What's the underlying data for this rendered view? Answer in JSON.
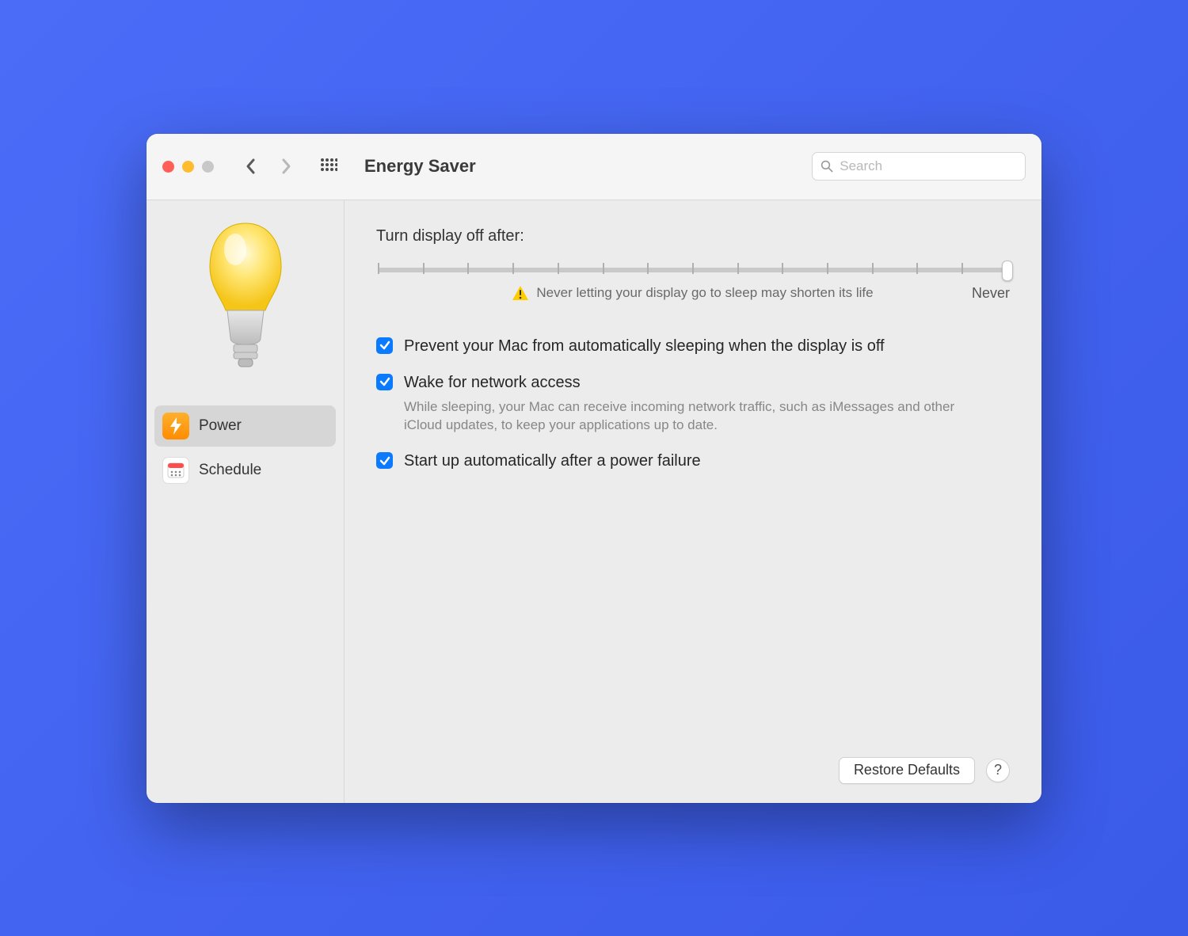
{
  "header": {
    "title": "Energy Saver",
    "search_placeholder": "Search"
  },
  "sidebar": {
    "tabs": [
      {
        "label": "Power"
      },
      {
        "label": "Schedule"
      }
    ]
  },
  "main": {
    "slider_label": "Turn display off after:",
    "slider_value_label": "Never",
    "warning_text": "Never letting your display go to sleep may shorten its life",
    "options": [
      {
        "label": "Prevent your Mac from automatically sleeping when the display is off",
        "checked": true
      },
      {
        "label": "Wake for network access",
        "description": "While sleeping, your Mac can receive incoming network traffic, such as iMessages and other iCloud updates, to keep your applications up to date.",
        "checked": true
      },
      {
        "label": "Start up automatically after a power failure",
        "checked": true
      }
    ],
    "restore_button": "Restore Defaults",
    "help_button": "?"
  }
}
